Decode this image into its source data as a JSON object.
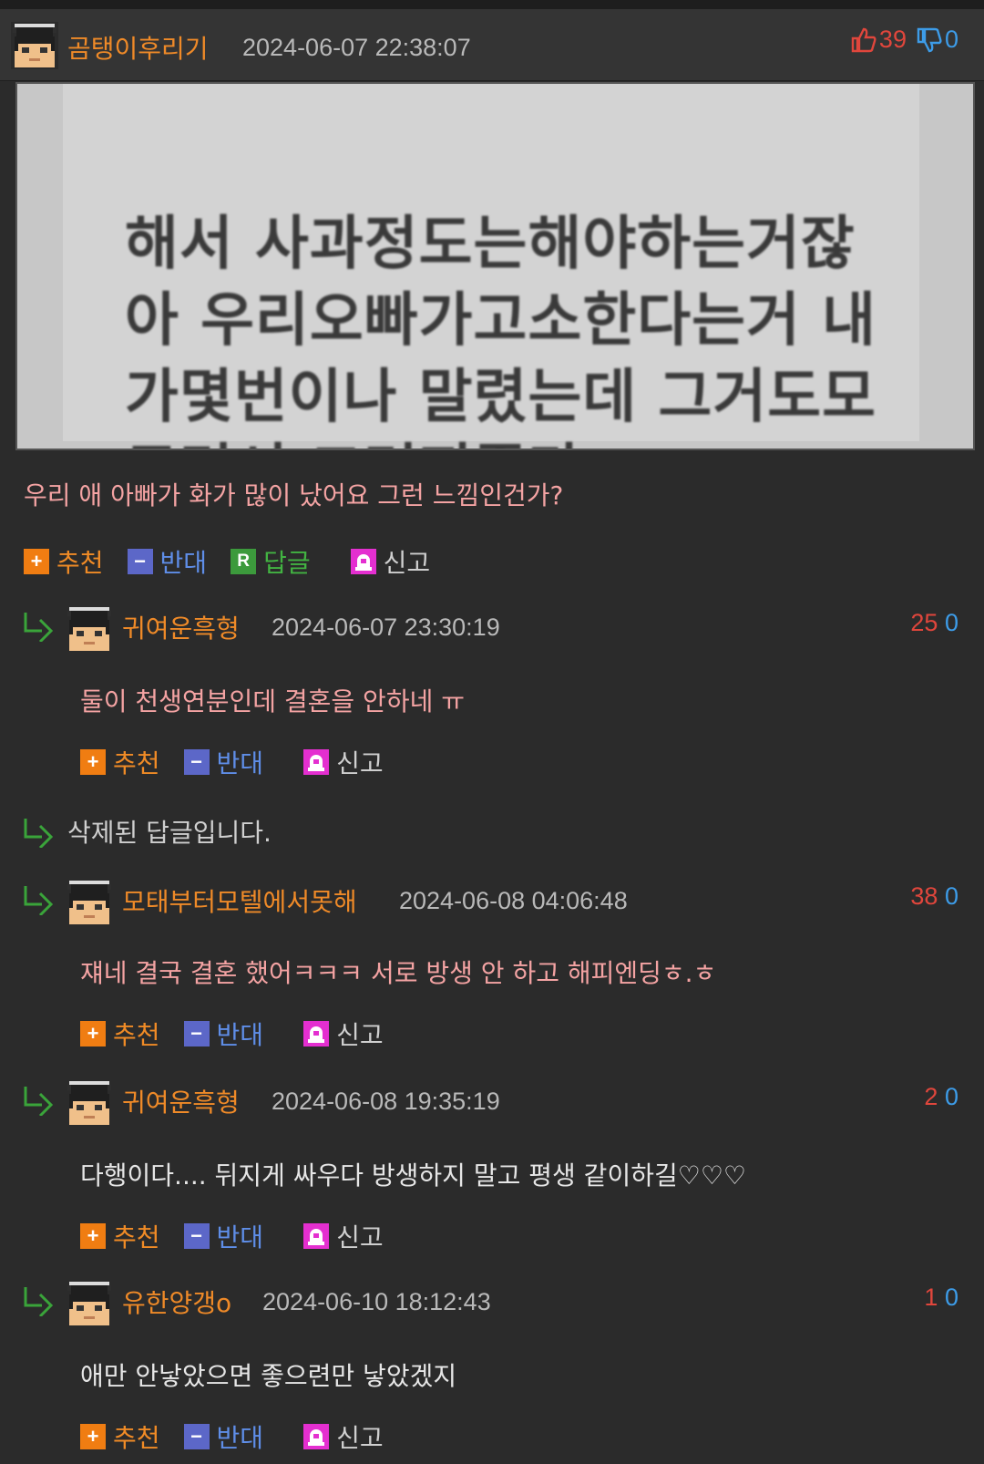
{
  "post": {
    "author": "곰탱이후리기",
    "date": "2024-06-07 22:38:07",
    "upvotes": "39",
    "downvotes": "0",
    "image_text": [
      "해서 사과정도는해야하는거잖",
      "아 우리오빠가고소한다는거 내",
      "가몇번이나 말렸는데 그거도모",
      "르면서 그러지좀마"
    ],
    "text": "우리 애 아빠가 화가 많이 났어요 그런 느낌인건가?"
  },
  "actions": {
    "recommend": "추천",
    "oppose": "반대",
    "reply": "답글",
    "report": "신고",
    "reply_icon": "R"
  },
  "comments": [
    {
      "author": "귀여운흑형",
      "date": "2024-06-07 23:30:19",
      "up": "25",
      "down": "0",
      "text": "둘이 천생연분인데 결혼을 안하네 ㅠ"
    },
    {
      "deleted": "삭제된 답글입니다."
    },
    {
      "author": "모태부터모텔에서못해",
      "date": "2024-06-08 04:06:48",
      "up": "38",
      "down": "0",
      "text": "쟤네 결국 결혼 했어ㅋㅋㅋ 서로 방생 안 하고 해피엔딩ㅎ.ㅎ"
    },
    {
      "author": "귀여운흑형",
      "date": "2024-06-08 19:35:19",
      "up": "2",
      "down": "0",
      "text": "다행이다.... 뒤지게 싸우다 방생하지 말고 평생 같이하길♡♡♡"
    },
    {
      "author": "유한양갱o",
      "date": "2024-06-10 18:12:43",
      "up": "1",
      "down": "0",
      "text": "애만 안낳았으면 좋으련만 낳았겠지"
    }
  ],
  "colors": {
    "background": "#2b2b2b",
    "username": "#ef8a28",
    "upvote": "#e0463c",
    "downvote": "#3d9ce8",
    "comment_text": "#f4a3a3"
  },
  "icons": [
    "avatar-icon",
    "thumbs-up-icon",
    "thumbs-down-icon",
    "plus-icon",
    "minus-icon",
    "reply-icon",
    "report-siren-icon",
    "reply-arrow-icon"
  ]
}
